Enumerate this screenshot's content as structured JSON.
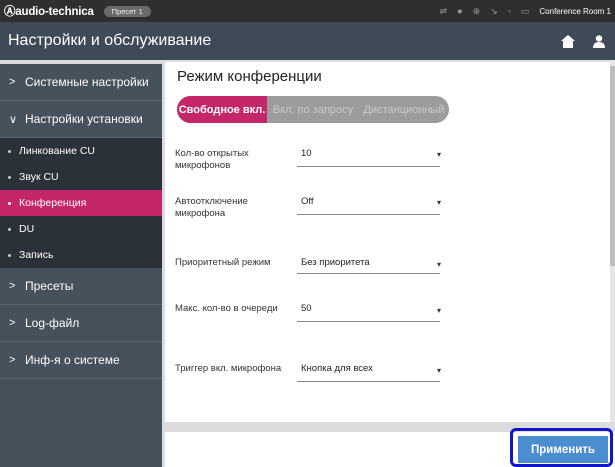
{
  "topbar": {
    "logo": "Ⓐaudio-technica",
    "preset": "Пресет 1",
    "room": "Conference Room 1",
    "icons": [
      "usb-icon",
      "record-icon",
      "sync-icon",
      "wireless-icon",
      "signal-icon",
      "display-icon"
    ]
  },
  "header": {
    "title": "Настройки и обслуживание",
    "icons": [
      "home-icon",
      "user-icon"
    ]
  },
  "sidebar": {
    "items": [
      {
        "label": "Системные настройки",
        "chevron": ">"
      },
      {
        "label": "Настройки установки",
        "chevron": "∨"
      }
    ],
    "subitems": [
      {
        "label": "Линкование CU"
      },
      {
        "label": "Звук CU"
      },
      {
        "label": "Конференция"
      },
      {
        "label": "DU"
      },
      {
        "label": "Запись"
      }
    ],
    "items_after": [
      {
        "label": "Пресеты",
        "chevron": ">"
      },
      {
        "label": "Log-файл",
        "chevron": ">"
      },
      {
        "label": "Инф-я о системе",
        "chevron": ">"
      }
    ]
  },
  "main": {
    "title": "Режим конференции",
    "modes": [
      "Свободное вкл.",
      "Вкл. по запросу",
      "Дистанционный"
    ],
    "active_mode": "Свободное вкл.",
    "fields": [
      {
        "label": "Кол-во открытых микрофонов",
        "value": "10"
      },
      {
        "label": "Автоотключение микрофона",
        "value": "Off"
      },
      {
        "label": "Приоритетный режим",
        "value": "Без приоритета"
      },
      {
        "label": "Макс. кол-во в очереди",
        "value": "50"
      },
      {
        "label": "Триггер вкл. микрофона",
        "value": "Кнопка для всех"
      }
    ],
    "caret": "▾"
  },
  "footer": {
    "apply_label": "Применить"
  },
  "colors": {
    "accent": "#c5266a",
    "header": "#3e4a56",
    "sidebar": "#46515c",
    "apply": "#4b8ed0",
    "highlight": "#1216c8"
  }
}
